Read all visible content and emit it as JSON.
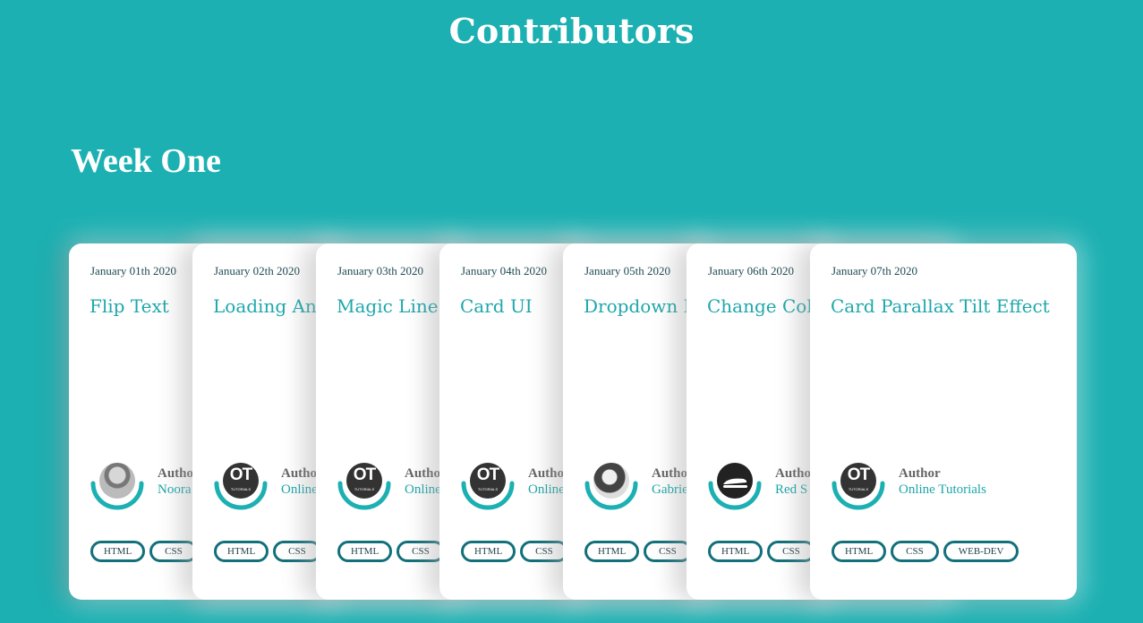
{
  "header": {
    "title": "Contributors"
  },
  "section": {
    "title": "Week One"
  },
  "author_label": "Author",
  "cards": [
    {
      "date": "January 01th 2020",
      "title": "Flip Text",
      "author": "Noora",
      "avatar": "photo-avatar",
      "tags": [
        "HTML",
        "CSS"
      ]
    },
    {
      "date": "January 02th 2020",
      "title": "Loading Ani",
      "author": "Online Tutorials",
      "avatar": "ot-logo-avatar",
      "tags": [
        "HTML",
        "CSS"
      ]
    },
    {
      "date": "January 03th 2020",
      "title": "Magic Line",
      "author": "Online Tutorials",
      "avatar": "ot-logo-avatar",
      "tags": [
        "HTML",
        "CSS"
      ]
    },
    {
      "date": "January 04th 2020",
      "title": "Card UI",
      "author": "Online Tutorials",
      "avatar": "ot-logo-avatar",
      "tags": [
        "HTML",
        "CSS"
      ]
    },
    {
      "date": "January 05th 2020",
      "title": "Dropdown N",
      "author": "Gabrie",
      "avatar": "photo-avatar",
      "tags": [
        "HTML",
        "CSS"
      ]
    },
    {
      "date": "January 06th 2020",
      "title": "Change Colo",
      "author": "Red S",
      "avatar": "stapler-avatar",
      "tags": [
        "HTML",
        "CSS"
      ]
    },
    {
      "date": "January 07th 2020",
      "title": "Card Parallax Tilt Effect",
      "author": "Online Tutorials",
      "avatar": "ot-logo-avatar",
      "tags": [
        "HTML",
        "CSS",
        "WEB-DEV"
      ]
    }
  ],
  "ot_logo": {
    "letters": "OT",
    "sub": "TUTORIALS"
  },
  "colors": {
    "background": "#1cb0b2",
    "accent": "#1ea7ab",
    "tag_border": "#12707a"
  }
}
